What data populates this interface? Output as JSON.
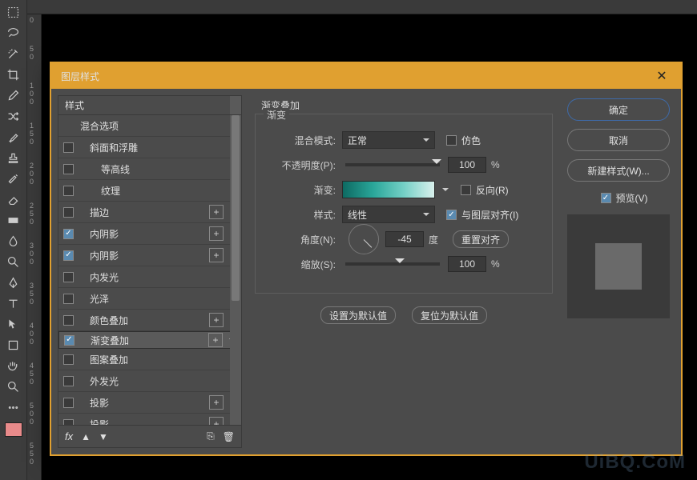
{
  "dialog": {
    "title": "图层样式"
  },
  "ruler": {
    "v": [
      "0",
      "5\n0",
      "1\n0\n0",
      "1\n5\n0",
      "2\n0\n0",
      "2\n5\n0",
      "3\n0\n0",
      "3\n5\n0",
      "4\n0\n0",
      "4\n5\n0",
      "5\n0\n0",
      "5\n5\n0"
    ]
  },
  "styles": {
    "header": "样式",
    "items": [
      {
        "label": "混合选项",
        "checked": null,
        "plus": false,
        "indent": 0
      },
      {
        "label": "斜面和浮雕",
        "checked": false,
        "plus": false,
        "indent": 1
      },
      {
        "label": "等高线",
        "checked": false,
        "plus": false,
        "indent": 2
      },
      {
        "label": "纹理",
        "checked": false,
        "plus": false,
        "indent": 2
      },
      {
        "label": "描边",
        "checked": false,
        "plus": true,
        "indent": 1
      },
      {
        "label": "内阴影",
        "checked": true,
        "plus": true,
        "indent": 1
      },
      {
        "label": "内阴影",
        "checked": true,
        "plus": true,
        "indent": 1
      },
      {
        "label": "内发光",
        "checked": false,
        "plus": false,
        "indent": 1
      },
      {
        "label": "光泽",
        "checked": false,
        "plus": false,
        "indent": 1
      },
      {
        "label": "颜色叠加",
        "checked": false,
        "plus": true,
        "indent": 1
      },
      {
        "label": "渐变叠加",
        "checked": true,
        "plus": true,
        "indent": 1,
        "selected": true
      },
      {
        "label": "图案叠加",
        "checked": false,
        "plus": false,
        "indent": 1
      },
      {
        "label": "外发光",
        "checked": false,
        "plus": false,
        "indent": 1
      },
      {
        "label": "投影",
        "checked": false,
        "plus": true,
        "indent": 1
      },
      {
        "label": "投影",
        "checked": false,
        "plus": true,
        "indent": 1
      }
    ],
    "fx": "fx"
  },
  "gradOverlay": {
    "title": "渐变叠加",
    "legend": "渐变",
    "blend": {
      "label": "混合模式:",
      "value": "正常"
    },
    "dither": {
      "label": "仿色"
    },
    "opacity": {
      "label": "不透明度(P):",
      "value": "100",
      "unit": "%"
    },
    "gradient": {
      "label": "渐变:"
    },
    "reverse": {
      "label": "反向(R)"
    },
    "style": {
      "label": "样式:",
      "value": "线性"
    },
    "align": {
      "label": "与图层对齐(I)"
    },
    "angle": {
      "label": "角度(N):",
      "value": "-45",
      "unit": "度"
    },
    "reset": {
      "label": "重置对齐"
    },
    "scale": {
      "label": "缩放(S):",
      "value": "100",
      "unit": "%"
    },
    "setDefault": "设置为默认值",
    "resetDefault": "复位为默认值"
  },
  "right": {
    "ok": "确定",
    "cancel": "取消",
    "newStyle": "新建样式(W)...",
    "preview": "预览(V)"
  },
  "watermark": "UiBQ.CoM"
}
